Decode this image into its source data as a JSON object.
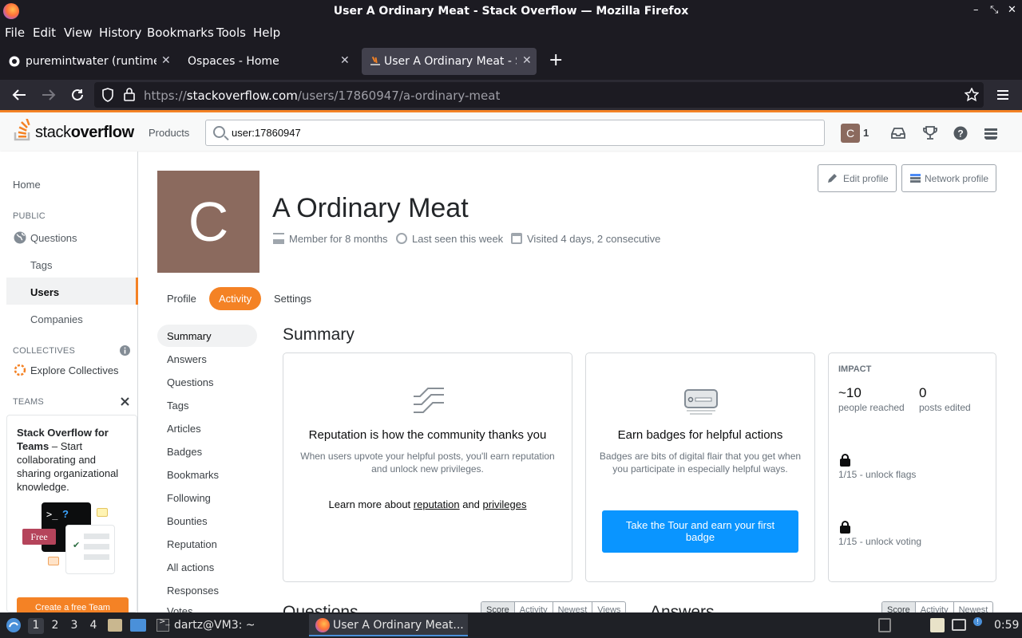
{
  "window": {
    "title": "User A Ordinary Meat - Stack Overflow — Mozilla Firefox",
    "controls": [
      "–",
      "⤡",
      "✕"
    ]
  },
  "menu": [
    "File",
    "Edit",
    "View",
    "History",
    "Bookmarks",
    "Tools",
    "Help"
  ],
  "tabs": [
    {
      "label": "puremintwater (runtime)"
    },
    {
      "label": "Ospaces - Home"
    },
    {
      "label": "User A Ordinary Meat - St"
    }
  ],
  "url": {
    "prefix": "https://",
    "domain": "stackoverflow.com",
    "path": "/users/17860947/a-ordinary-meat"
  },
  "so": {
    "logo_plain": "stack",
    "logo_bold": "overflow",
    "products": "Products",
    "search_value": "user:17860947",
    "avatar_letter": "C",
    "reputation": "1"
  },
  "leftnav": {
    "home": "Home",
    "public": "PUBLIC",
    "questions": "Questions",
    "tags": "Tags",
    "users": "Users",
    "companies": "Companies",
    "collectives": "COLLECTIVES",
    "explore": "Explore Collectives",
    "teams": "TEAMS",
    "teams_title": "Stack Overflow for Teams",
    "teams_text": " – Start collaborating and sharing organizational knowledge.",
    "free": "Free",
    "create_team": "Create a free Team"
  },
  "profile": {
    "avatar_letter": "C",
    "name": "A Ordinary Meat",
    "member": "Member for 8 months",
    "seen": "Last seen this week",
    "visited": "Visited 4 days, 2 consecutive",
    "edit_profile": "Edit profile",
    "network_profile": "Network profile"
  },
  "profile_tabs": [
    "Profile",
    "Activity",
    "Settings"
  ],
  "activity_nav": [
    "Summary",
    "Answers",
    "Questions",
    "Tags",
    "Articles",
    "Badges",
    "Bookmarks",
    "Following",
    "Bounties",
    "Reputation",
    "All actions",
    "Responses",
    "Votes"
  ],
  "summary": {
    "heading": "Summary",
    "rep_title": "Reputation is how the community thanks you",
    "rep_text": "When users upvote your helpful posts, you'll earn reputation and unlock new privileges.",
    "learn_more": "Learn more about ",
    "reputation_link": "reputation",
    "and": " and ",
    "privileges_link": "privileges",
    "badge_title": "Earn badges for helpful actions",
    "badge_text": "Badges are bits of digital flair that you get when you participate in especially helpful ways.",
    "tour_button": "Take the Tour and earn your first badge",
    "impact_label": "IMPACT",
    "reached_num": "~10",
    "reached_label": "people reached",
    "edited_num": "0",
    "edited_label": "posts edited",
    "unlock_flags": "1/15 - unlock flags",
    "unlock_voting": "1/15 - unlock voting"
  },
  "bottom": {
    "questions": "Questions",
    "answers": "Answers",
    "sort_q": [
      "Score",
      "Activity",
      "Newest",
      "Views"
    ],
    "sort_a": [
      "Score",
      "Activity",
      "Newest"
    ]
  },
  "taskbar": {
    "workspaces": [
      "1",
      "2",
      "3",
      "4"
    ],
    "terminal": "dartz@VM3: ~",
    "firefox": "User A Ordinary Meat...",
    "clock": "0:59"
  },
  "colors": {
    "accent": "#f48225",
    "blue_button": "#0a95ff",
    "avatar": "#8b6a5e"
  }
}
